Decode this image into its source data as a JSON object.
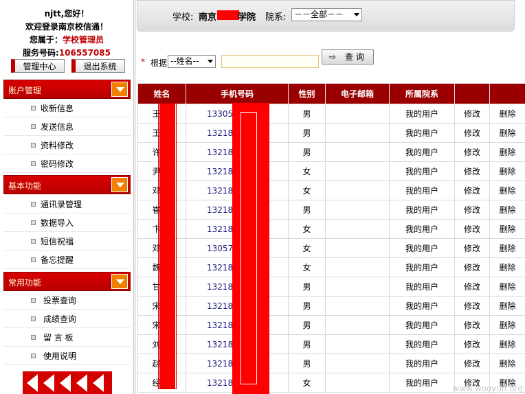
{
  "user": {
    "greeting": "njtt,您好！",
    "welcome": "欢迎登录南京校信通！",
    "role_prefix": "您属于：",
    "role": "学校管理员",
    "service_prefix": "服务号码:",
    "service_number": "106557085"
  },
  "top_buttons": {
    "admin_center": "管理中心",
    "logout": "退出系统"
  },
  "sidebar": {
    "sections": [
      {
        "title": "账户管理",
        "items": [
          "收新信息",
          "发送信息",
          "资料修改",
          "密码修改"
        ]
      },
      {
        "title": "基本功能",
        "items": [
          "通讯录管理",
          "数据导入",
          "短信祝福",
          "备忘提醒"
        ]
      },
      {
        "title": "常用功能",
        "items": [
          "投票查询",
          "成绩查询",
          "留 言 板",
          "使用说明"
        ]
      }
    ]
  },
  "filter": {
    "school_label": "学校:",
    "school_value_prefix": "南京",
    "school_value_suffix": "学院",
    "dept_label": "院系:",
    "dept_value": "－－全部－－"
  },
  "search": {
    "star": "*",
    "label": "根据",
    "select_value": "--姓名--",
    "input_value": "",
    "button_label": "查 询",
    "button_icon": "⇨"
  },
  "table": {
    "headers": [
      "姓名",
      "手机号码",
      "性别",
      "电子邮箱",
      "所属院系",
      "",
      ""
    ],
    "rows": [
      {
        "name": "王  靖",
        "phone": "13305",
        "gender": "男",
        "email": "",
        "dept": "我的用户",
        "edit": "修改",
        "del": "删除"
      },
      {
        "name": "王  晖",
        "phone": "13218",
        "gender": "男",
        "email": "",
        "dept": "我的用户",
        "edit": "修改",
        "del": "删除"
      },
      {
        "name": "许  刚",
        "phone": "13218",
        "gender": "男",
        "email": "",
        "dept": "我的用户",
        "edit": "修改",
        "del": "删除"
      },
      {
        "name": "尹  丽",
        "phone": "13218",
        "gender": "女",
        "email": "",
        "dept": "我的用户",
        "edit": "修改",
        "del": "删除"
      },
      {
        "name": "邓  华",
        "phone": "13218",
        "gender": "女",
        "email": "",
        "dept": "我的用户",
        "edit": "修改",
        "del": "删除"
      },
      {
        "name": "崔  超",
        "phone": "13218",
        "gender": "男",
        "email": "",
        "dept": "我的用户",
        "edit": "修改",
        "del": "删除"
      },
      {
        "name": "卞  燕",
        "phone": "13218",
        "gender": "女",
        "email": "",
        "dept": "我的用户",
        "edit": "修改",
        "del": "删除"
      },
      {
        "name": "邓  丽",
        "phone": "13057",
        "gender": "女",
        "email": "",
        "dept": "我的用户",
        "edit": "修改",
        "del": "删除"
      },
      {
        "name": "魏  云",
        "phone": "13218",
        "gender": "女",
        "email": "",
        "dept": "我的用户",
        "edit": "修改",
        "del": "删除"
      },
      {
        "name": "甘  涛",
        "phone": "13218",
        "gender": "男",
        "email": "",
        "dept": "我的用户",
        "edit": "修改",
        "del": "删除"
      },
      {
        "name": "宋  超",
        "phone": "13218",
        "gender": "男",
        "email": "",
        "dept": "我的用户",
        "edit": "修改",
        "del": "删除"
      },
      {
        "name": "宋  康",
        "phone": "13218",
        "gender": "男",
        "email": "",
        "dept": "我的用户",
        "edit": "修改",
        "del": "删除"
      },
      {
        "name": "刘  强",
        "phone": "13218",
        "gender": "男",
        "email": "",
        "dept": "我的用户",
        "edit": "修改",
        "del": "删除"
      },
      {
        "name": "赵  滨",
        "phone": "13218",
        "gender": "男",
        "email": "",
        "dept": "我的用户",
        "edit": "修改",
        "del": "删除"
      },
      {
        "name": "经  素",
        "phone": "13218",
        "gender": "女",
        "email": "",
        "dept": "我的用户",
        "edit": "修改",
        "del": "删除"
      }
    ]
  },
  "watermark": "www.wooyun.org",
  "colors": {
    "accent_red": "#c00000",
    "header_red": "#9a0000",
    "section_arrow": "#f08000",
    "redaction": "#ff0000"
  }
}
